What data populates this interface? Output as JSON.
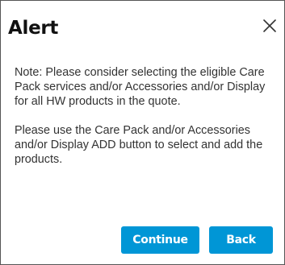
{
  "dialog": {
    "title": "Alert",
    "close_icon": "close-icon",
    "body": {
      "paragraph_1": "Note: Please consider selecting the eligible Care Pack services and/or Accessories and/or Display for all HW products in the quote.",
      "paragraph_2": "Please use the Care Pack and/or Accessories and/or Display ADD button to select and add the products."
    },
    "buttons": {
      "continue_label": "Continue",
      "back_label": "Back"
    }
  },
  "colors": {
    "button_bg": "#0096d6",
    "button_text": "#ffffff",
    "border": "#555555",
    "title": "#111111",
    "body_text": "#333333"
  }
}
